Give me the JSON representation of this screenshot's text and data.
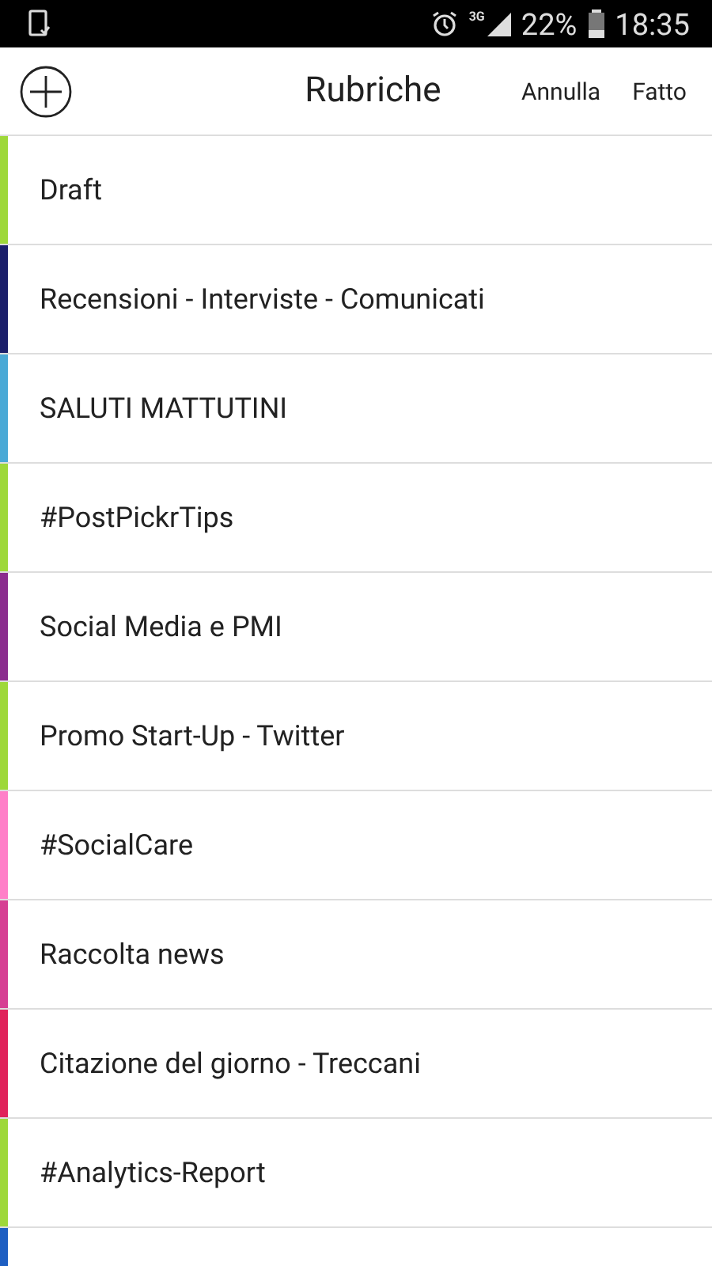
{
  "status_bar": {
    "network": "3G",
    "battery": "22%",
    "time": "18:35"
  },
  "header": {
    "title": "Rubriche",
    "actions": [
      "Annulla",
      "Fatto"
    ]
  },
  "categories": [
    {
      "label": "Draft",
      "color": "#9ed83a"
    },
    {
      "label": "Recensioni - Interviste - Comunicati",
      "color": "#1b1f6b"
    },
    {
      "label": "SALUTI MATTUTINI",
      "color": "#4aa9d6"
    },
    {
      "label": "#PostPickrTips",
      "color": "#9ed83a"
    },
    {
      "label": "Social Media e PMI",
      "color": "#8b2d8e"
    },
    {
      "label": "Promo Start-Up - Twitter",
      "color": "#9ed83a"
    },
    {
      "label": "#SocialCare",
      "color": "#ff7fc8"
    },
    {
      "label": "Raccolta news",
      "color": "#d63f93"
    },
    {
      "label": "Citazione del giorno - Treccani",
      "color": "#e0225a"
    },
    {
      "label": "#Analytics-Report",
      "color": "#9ed83a"
    },
    {
      "color": "#1e5fc2"
    }
  ]
}
